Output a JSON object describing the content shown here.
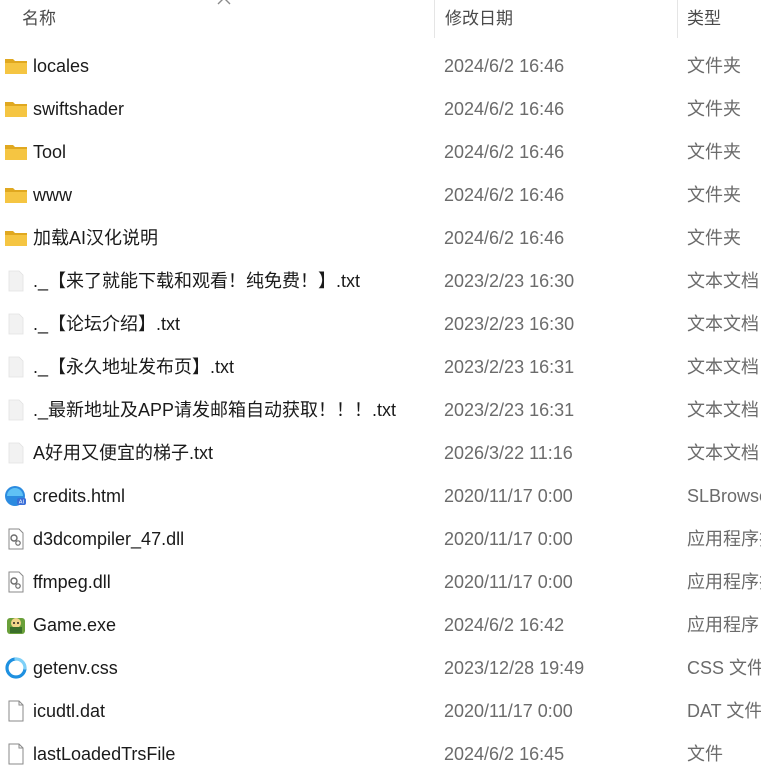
{
  "columns": {
    "name": "名称",
    "date": "修改日期",
    "type": "类型"
  },
  "colors": {
    "folder": "#F5C542",
    "folder_dark": "#E0A820",
    "text_primary": "#1a1a1a",
    "text_secondary": "#6b6b6b"
  },
  "rows": [
    {
      "name": "locales",
      "date": "2024/6/2 16:46",
      "type": "文件夹",
      "icon": "folder-icon"
    },
    {
      "name": "swiftshader",
      "date": "2024/6/2 16:46",
      "type": "文件夹",
      "icon": "folder-icon"
    },
    {
      "name": "Tool",
      "date": "2024/6/2 16:46",
      "type": "文件夹",
      "icon": "folder-icon"
    },
    {
      "name": "www",
      "date": "2024/6/2 16:46",
      "type": "文件夹",
      "icon": "folder-icon"
    },
    {
      "name": "加载AI汉化说明",
      "date": "2024/6/2 16:46",
      "type": "文件夹",
      "icon": "folder-icon"
    },
    {
      "name": "._【来了就能下载和观看！纯免费！】.txt",
      "date": "2023/2/23 16:30",
      "type": "文本文档",
      "icon": "text-file-icon"
    },
    {
      "name": "._【论坛介绍】.txt",
      "date": "2023/2/23 16:30",
      "type": "文本文档",
      "icon": "text-file-icon"
    },
    {
      "name": "._【永久地址发布页】.txt",
      "date": "2023/2/23 16:31",
      "type": "文本文档",
      "icon": "text-file-icon"
    },
    {
      "name": "._最新地址及APP请发邮箱自动获取！！！.txt",
      "date": "2023/2/23 16:31",
      "type": "文本文档",
      "icon": "text-file-icon"
    },
    {
      "name": "A好用又便宜的梯子.txt",
      "date": "2026/3/22 11:16",
      "type": "文本文档",
      "icon": "text-file-icon"
    },
    {
      "name": "credits.html",
      "date": "2020/11/17 0:00",
      "type": "SLBrowser",
      "icon": "browser-html-icon"
    },
    {
      "name": "d3dcompiler_47.dll",
      "date": "2020/11/17 0:00",
      "type": "应用程序扩展",
      "icon": "dll-icon"
    },
    {
      "name": "ffmpeg.dll",
      "date": "2020/11/17 0:00",
      "type": "应用程序扩展",
      "icon": "dll-icon"
    },
    {
      "name": "Game.exe",
      "date": "2024/6/2 16:42",
      "type": "应用程序",
      "icon": "game-exe-icon"
    },
    {
      "name": "getenv.css",
      "date": "2023/12/28 19:49",
      "type": "CSS 文件",
      "icon": "css-file-icon"
    },
    {
      "name": "icudtl.dat",
      "date": "2020/11/17 0:00",
      "type": "DAT 文件",
      "icon": "blank-file-icon"
    },
    {
      "name": "lastLoadedTrsFile",
      "date": "2024/6/2 16:45",
      "type": "文件",
      "icon": "blank-file-icon"
    }
  ]
}
